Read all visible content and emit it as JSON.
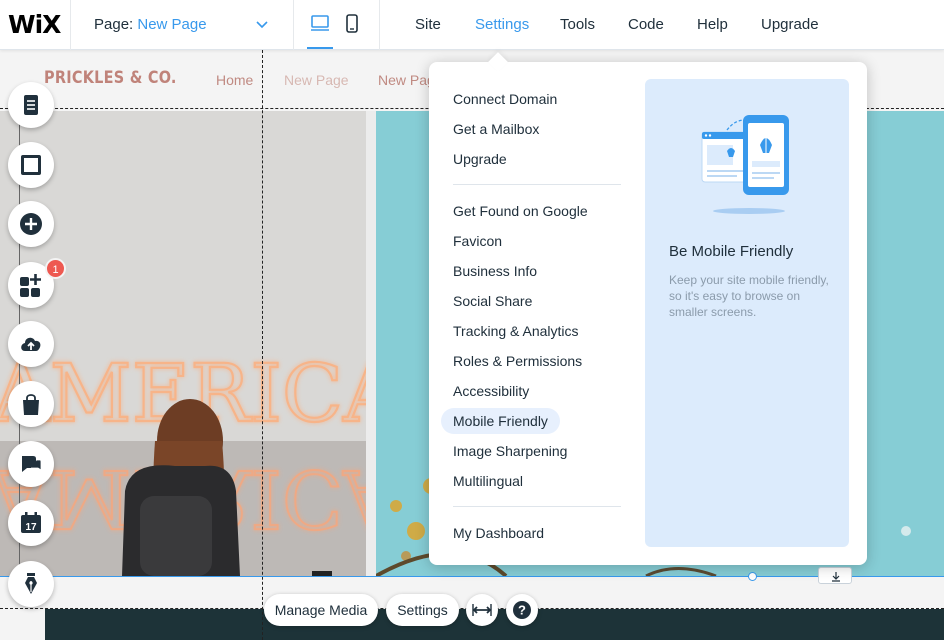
{
  "topbar": {
    "logo": "WiX",
    "page_label": "Page:",
    "page_value": "New Page",
    "nav": [
      {
        "label": "Site"
      },
      {
        "label": "Settings",
        "active": true
      },
      {
        "label": "Tools"
      },
      {
        "label": "Code"
      },
      {
        "label": "Help"
      },
      {
        "label": "Upgrade"
      }
    ],
    "collapse_icon": "^"
  },
  "site": {
    "logo": "PRICKLES & CO.",
    "nav": [
      "Home",
      "New Page",
      "New Pag"
    ]
  },
  "left_tools": [
    {
      "icon": "pages-icon"
    },
    {
      "icon": "background-icon"
    },
    {
      "icon": "add-icon"
    },
    {
      "icon": "app-market-icon",
      "badge": "1"
    },
    {
      "icon": "upload-icon"
    },
    {
      "icon": "store-icon"
    },
    {
      "icon": "chat-icon"
    },
    {
      "icon": "calendar-icon",
      "text": "17"
    },
    {
      "icon": "pen-icon"
    }
  ],
  "bottom_toolbar": {
    "manage_media": "Manage Media",
    "settings": "Settings"
  },
  "photo": {
    "neon_text": "AMERICA"
  },
  "settings_menu": {
    "group1": [
      "Connect Domain",
      "Get a Mailbox",
      "Upgrade"
    ],
    "group2": [
      "Get Found on Google",
      "Favicon",
      "Business Info",
      "Social Share",
      "Tracking & Analytics",
      "Roles & Permissions",
      "Accessibility",
      "Mobile Friendly",
      "Image Sharpening",
      "Multilingual"
    ],
    "group3": [
      "My Dashboard"
    ],
    "highlighted": "Mobile Friendly",
    "promo": {
      "title": "Be Mobile Friendly",
      "text": "Keep your site mobile friendly, so it's easy to browse on smaller screens."
    }
  },
  "colors": {
    "accent": "#3899ec",
    "badge": "#ee5951",
    "promo_bg": "#dcebfc",
    "site_logo": "#c0837a"
  }
}
